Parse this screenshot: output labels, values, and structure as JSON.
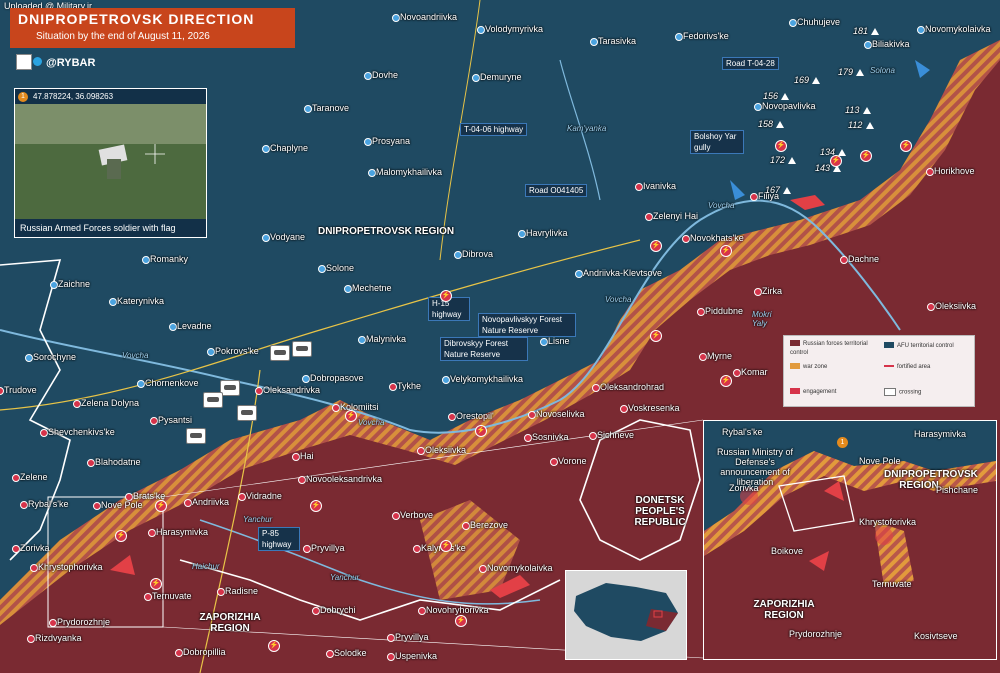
{
  "watermark": "Uploaded @ Military.ir",
  "header": {
    "title": "DNIPROPETROVSK DIRECTION",
    "subtitle": "Situation by the end of August 11, 2026"
  },
  "brand": "@RYBAR",
  "photo": {
    "number": "1",
    "coords": "47.878224, 36.098263",
    "caption": "Russian Armed Forces soldier with flag"
  },
  "colors": {
    "afu_territory": "#1f4a62",
    "russian_territory": "#7a2a32",
    "war_zone": "#e29a3c",
    "header_bg": "#c8451c"
  },
  "regions": {
    "dnipropetrovsk": "DNIPROPETROVSK REGION",
    "donetsk": "DONETSK PEOPLE'S REPUBLIC",
    "zaporizhia": "ZAPORIZHIA REGION"
  },
  "roads": {
    "t0406": "T-04-06 highway",
    "o041405": "Road O041405",
    "t0428": "Road T-04-28",
    "h15": "H-15 highway",
    "p85": "P-85 highway",
    "bolshoy_yar": "Bolshoy Yar gully"
  },
  "forests": {
    "novopavlivskyy": "Novopavlivskyy Forest Nature Reserve",
    "dibrovskyy": "Dibrovskyy Forest Nature Reserve"
  },
  "rivers": {
    "vovcha1": "Vovcha",
    "vovcha2": "Vovcha",
    "vovcha3": "Vovcha",
    "vovcha4": "Vovcha",
    "yanchur1": "Yanchur",
    "yanchur2": "Yanchur",
    "haichur": "Haichur",
    "kamyanka": "Kam'yanka",
    "mokri_yaly": "Mokri Yaly",
    "solona": "Solona"
  },
  "heights": [
    "181",
    "179",
    "169",
    "156",
    "158",
    "113",
    "112",
    "134",
    "172",
    "143",
    "167"
  ],
  "settlements": [
    "Novoandriivka",
    "Volodymyrivka",
    "Tarasivka",
    "Fedorivs'ke",
    "Chuhujeve",
    "Biliakivka",
    "Novomykolaivka",
    "Dovhe",
    "Demuryne",
    "Taranove",
    "Novopavlivka",
    "Prosyana",
    "Chaplyne",
    "Malomykhailivka",
    "Ivanivka",
    "Horikhove",
    "Filiya",
    "Zelenyi Hai",
    "Vodyane",
    "Havrylivka",
    "Novokhats'ke",
    "Dachne",
    "Romanky",
    "Solone",
    "Dibrova",
    "Andriivka-Klevtsove",
    "Zaichne",
    "Katerynivka",
    "Mechetne",
    "Zirka",
    "Oleksiivka",
    "Levadne",
    "Malynivka",
    "Piddubne",
    "Sorochyne",
    "Pokrovs'ke",
    "Lisne",
    "Myrne",
    "Trudove",
    "Chornenkove",
    "Dobropasove",
    "Velykomykhailivka",
    "Komar",
    "Oleksandrohrad",
    "Zelena Dolyna",
    "Oleksandrivka",
    "Tykhe",
    "Kolomiitsi",
    "Orestopil'",
    "Novoselivka",
    "Voskresenka",
    "Pysantsi",
    "Shevchenkivs'ke",
    "Sosnivka",
    "Sichneve",
    "Hai",
    "Blahodatne",
    "Oleksiivka",
    "Vorone",
    "Zelene",
    "Novooleksandrivka",
    "Brats'ke",
    "Andriivka",
    "Vidradne",
    "Rybal's'ke",
    "Nove Pole",
    "Verbove",
    "Harasymivka",
    "Berezove",
    "Zorivka",
    "Pryvillya",
    "Kalynivs'ke",
    "Khrystophorivka",
    "Novomykolaivka",
    "Ternuvate",
    "Radisne",
    "Dobrychi",
    "Novohryhorivka",
    "Prydorozhnje",
    "Pryvillya",
    "Rizdvyanka",
    "Dobropillia",
    "Solodke",
    "Uspenivka"
  ],
  "legend": {
    "russian": "Russian forces territorial control",
    "afu": "AFU territorial control",
    "war_zone": "war zone",
    "fortified": "fortified area",
    "engagement": "engagement",
    "crossing": "crossing"
  },
  "inset": {
    "announcement": "Russian Ministry of Defense's announcement of liberation",
    "region_top": "DNIPROPETROVSK REGION",
    "region_bottom": "ZAPORIZHIA REGION",
    "number": "1",
    "places": [
      "Rybal's'ke",
      "Harasymivka",
      "Nove Pole",
      "Pishchane",
      "Zorivka",
      "Khrystoforivka",
      "Boikove",
      "Ternuvate",
      "Prydorozhnje",
      "Kosivtseve"
    ]
  }
}
